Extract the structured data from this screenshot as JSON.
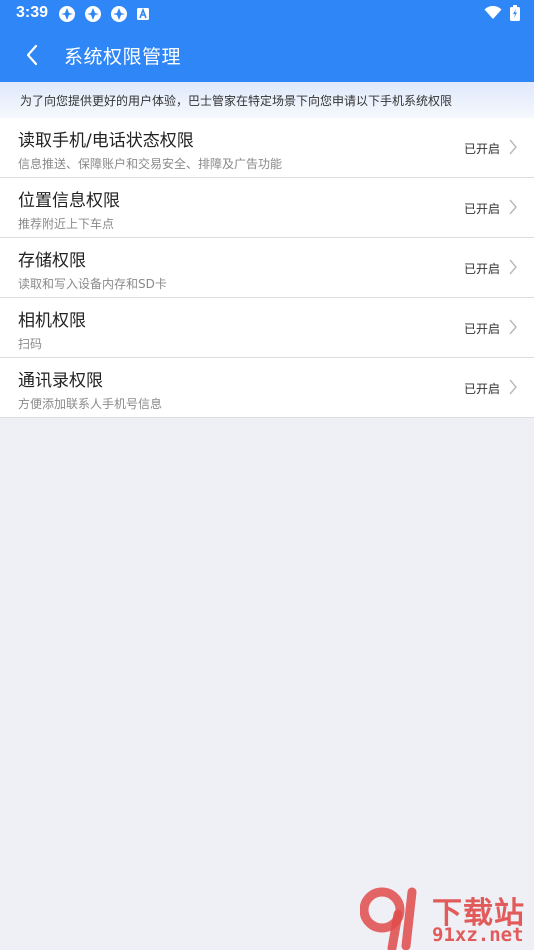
{
  "status_bar": {
    "time": "3:39",
    "left_icons": [
      "notification-app-icon",
      "notification-app-icon",
      "notification-app-icon",
      "text-a-icon"
    ],
    "right_icons": [
      "wifi-icon",
      "battery-charging-icon"
    ]
  },
  "header": {
    "back_icon": "chevron-left-icon",
    "title": "系统权限管理",
    "color": "#2f86f6"
  },
  "notice": {
    "text": "为了向您提供更好的用户体验，巴士管家在特定场景下向您申请以下手机系统权限"
  },
  "permissions": [
    {
      "title": "读取手机/电话状态权限",
      "desc": "信息推送、保障账户和交易安全、排障及广告功能",
      "status": "已开启"
    },
    {
      "title": "位置信息权限",
      "desc": "推荐附近上下车点",
      "status": "已开启"
    },
    {
      "title": "存储权限",
      "desc": "读取和写入设备内存和SD卡",
      "status": "已开启"
    },
    {
      "title": "相机权限",
      "desc": "扫码",
      "status": "已开启"
    },
    {
      "title": "通讯录权限",
      "desc": "方便添加联系人手机号信息",
      "status": "已开启"
    }
  ],
  "watermark": {
    "cn": "下载站",
    "en": "91xz.net",
    "color": "#e14b4b"
  }
}
